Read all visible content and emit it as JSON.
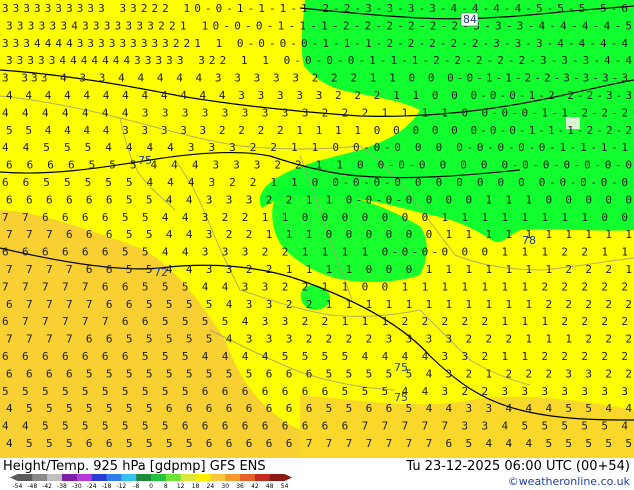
{
  "footer": {
    "title": "Height/Temp. 925 hPa [gdpmp] GFS ENS",
    "valid_time": "Tu 23-12-2025 06:00 UTC (00+54)",
    "copyright": "©weatheronline.co.uk"
  },
  "map": {
    "land_color": "#ffff00",
    "warm_land_color": "#f7c83a",
    "cold_zone_color": "#00ff33",
    "border_color": "#9c9c78",
    "contour_color": "#000000",
    "contour_labels": [
      {
        "value": "84"
      },
      {
        "value": "75"
      },
      {
        "value": "72"
      },
      {
        "value": "78"
      },
      {
        "value": "75"
      },
      {
        "value": "75"
      }
    ],
    "temperature_rows": [
      "3333333333 33222 10-0-1-1-1-1-2-2-3-3-3-3-4-4-4-4-5-5-5-5-6",
      "33333343333333221 10-0-0-1-1-1-2-2-2-2-2-2-3-3-3-4-4-4-4-5",
      "3334444333333333221 1 0-0-0-0-1-1-1-2-2-2-2-2-3-3-3-4-4-4-4",
      "33333444444433333 322 1 1 0-0-0-0-1-1-1-2-2-2-2-2-3-3-3-4-4",
      "3 333 4 3 3 4 4 4 4 4 3 3 3 3 3 2 2 2 1 1 0 0 0-0-1-1-2-2-3-3-3-3",
      "4 4 4 4 4 4 4 4 4 4 4 4 3 3 3 3 3 2 2 2 1 1 0 0 0-0-0-1-2-2-2-3-3",
      "4 4 4 4 4 4 4 3 3 3 3 3 3 3 3 3 2 2 2 1 1 1 1 0 0-0-0-1-1-2-2-2",
      "5 5 4 4 4 4 3 3 3 3 3 2 2 2 2 1 1 1 1 0 0 0 0 0 0-0-0-1-1-1-2-2-2",
      "4 4 5 5 5 4 4 4 4 3 3 3 2 2 1 1 0 0-0-0 0 0 0-0-0-0-0-1-1-1-1",
      "6 6 6 6 5 5 5 4 4 4 3 3 3 2 2 1 1 0 0-0-0 0 0 0 0-0-0-0-0-0-0",
      "6 6 5 5 5 5 5 4 4 4 3 2 2 1 1 0 0-0-0-0 0 0 0 0 0 0 0-0-0-0-0",
      "6 6 6 6 6 6 5 5 4 4 3 3 3 2 2 1 1 0-0-0-0 0 0 0 1 1 1 0 0 0 0 0",
      "7 7 6 6 6 6 5 5 4 4 3 2 2 1 1 0 0 0 0 0 0 0 1 1 1 1 1 1 1 1 0 0",
      "7 7 7 6 6 6 5 5 4 4 3 2 2 1 1 1 0 0 0 0 0 0 1 1 1 1 1 1 1 1 1 1",
      "6 6 6 6 6 6 5 5 4 4 3 3 3 2 2 1 1 1 1 0-0-0-0 0 0 1 1 1 2 2 1 1",
      "7 7 7 7 6 6 5 5 4 4 3 3 2 2 1 1 1 1 0 0 0 1 1 1 1 1 1 1 2 2 2 1",
      "7 7 7 7 7 6 6 5 5 5 4 4 3 3 2 2 1 1 0 0 1 1 1 1 1 1 1 2 2 2 2 2",
      "6 7 7 7 7 6 6 5 5 5 5 4 3 3 2 2 1 1 1 1 1 1 1 1 1 1 1 2 2 2 2 2",
      "6 7 7 7 7 7 6 6 5 5 5 5 4 3 3 2 2 1 1 1 2 2 2 2 2 1 1 1 2 2 2 2",
      "7 7 7 7 6 6 5 5 5 5 5 4 3 3 3 2 2 2 2 3 3 3 3 2 2 2 1 1 1 2 2 2",
      "6 6 6 6 6 6 6 5 5 5 4 4 4 4 5 5 5 5 4 4 4 4 3 3 2 1 1 2 2 2 2 2",
      "6 6 6 6 5 5 5 5 5 5 5 5 5 6 6 6 5 5 5 5 5 4 3 2 1 2 2 2 3 3 2 2",
      "5 5 5 5 5 5 5 5 5 5 6 6 6 6 6 6 6 5 5 5 4 4 3 2 2 3 3 3 3 3 3 3",
      "4 5 5 5 5 5 5 5 6 6 6 6 6 6 6 6 5 5 6 6 5 4 4 3 3 4 4 4 5 5 4 4",
      "4 4 5 5 5 5 5 5 5 6 6 6 6 6 6 6 6 6 7 7 7 7 7 3 3 4 5 5 5 5 5 4",
      "4 5 5 5 6 6 5 5 5 5 6 6 6 6 6 7 7 7 7 7 7 7 6 5 4 4 4 5 5 5 5 5"
    ]
  },
  "scale": {
    "labels": [
      "-54",
      "-48",
      "-42",
      "-38",
      "-30",
      "-24",
      "-18",
      "-12",
      "-8",
      "0",
      "8",
      "12",
      "18",
      "24",
      "30",
      "36",
      "42",
      "48",
      "54"
    ],
    "colors": [
      "#5a5a5a",
      "#8a8a8a",
      "#c0c0c0",
      "#7d1fa8",
      "#b43ad9",
      "#2a3bd6",
      "#2e7de8",
      "#36c2f0",
      "#1c8a3a",
      "#22c23a",
      "#6fe23a",
      "#d8e83a",
      "#fff000",
      "#f7c83a",
      "#f49a2c",
      "#e8602a",
      "#c72a1f",
      "#8c1a14"
    ]
  }
}
